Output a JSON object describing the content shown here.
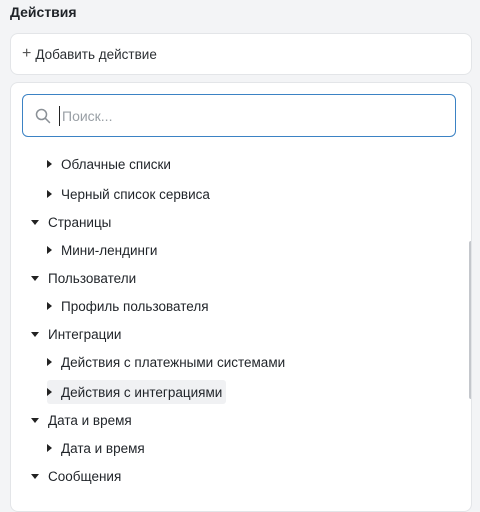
{
  "section": {
    "title": "Действия"
  },
  "add_action": {
    "label": "Добавить действие"
  },
  "search": {
    "placeholder": "Поиск..."
  },
  "tree": [
    {
      "label": "Облачные списки",
      "level": 1,
      "expanded": false
    },
    {
      "label": "Черный список сервиса",
      "level": 1,
      "expanded": false
    },
    {
      "label": "Страницы",
      "level": 0,
      "expanded": true
    },
    {
      "label": "Мини-лендинги",
      "level": 1,
      "expanded": false
    },
    {
      "label": "Пользователи",
      "level": 0,
      "expanded": true
    },
    {
      "label": "Профиль пользователя",
      "level": 1,
      "expanded": false
    },
    {
      "label": "Интеграции",
      "level": 0,
      "expanded": true
    },
    {
      "label": "Действия с платежными системами",
      "level": 1,
      "expanded": false
    },
    {
      "label": "Действия с интеграциями",
      "level": 1,
      "expanded": false,
      "hovered": true
    },
    {
      "label": "Дата и время",
      "level": 0,
      "expanded": true
    },
    {
      "label": "Дата и время",
      "level": 1,
      "expanded": false
    },
    {
      "label": "Сообщения",
      "level": 0,
      "expanded": true
    }
  ],
  "colors": {
    "accent": "#3b82c4",
    "background": "#f3f4f6",
    "panel": "#ffffff"
  }
}
